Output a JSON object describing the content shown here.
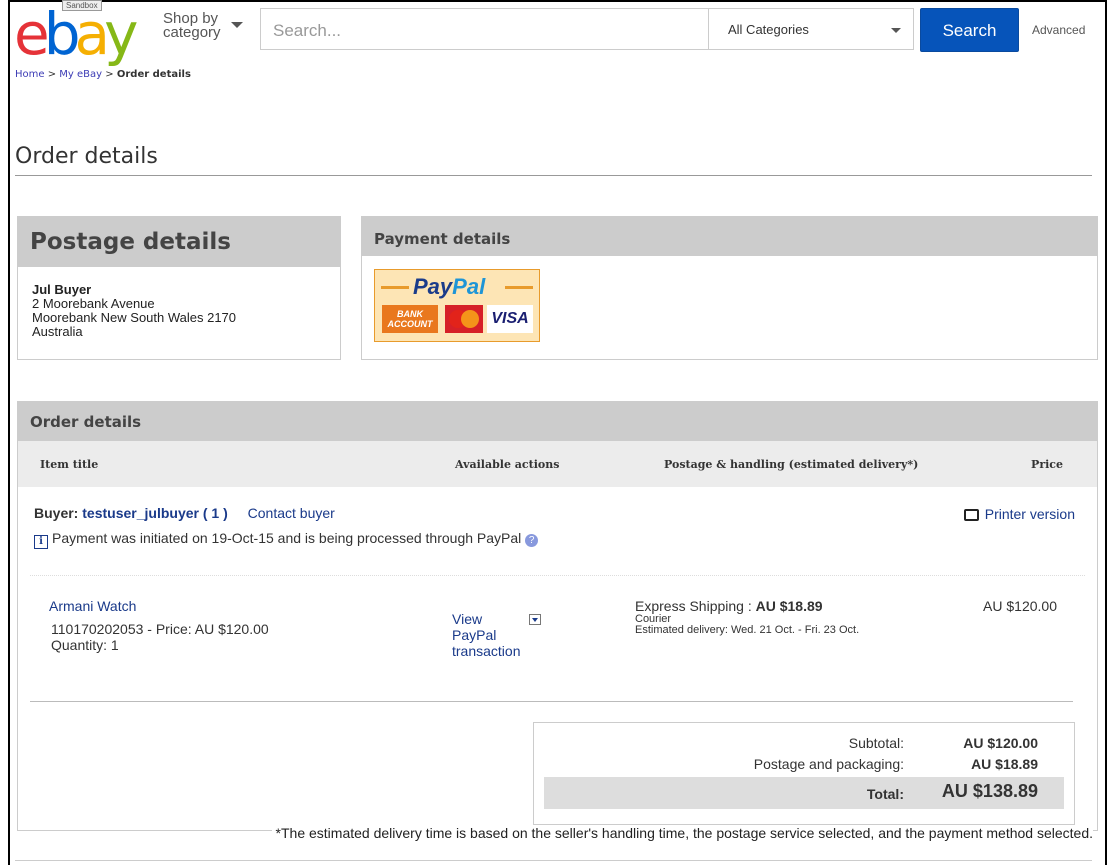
{
  "header": {
    "logo_text": "ebay",
    "sandbox_badge": "Sandbox",
    "shop_by_line1": "Shop by",
    "shop_by_line2": "category",
    "search_placeholder": "Search...",
    "category_selected": "All Categories",
    "search_button": "Search",
    "advanced_link": "Advanced",
    "logo_colors": [
      "#e53238",
      "#0064d2",
      "#f5af02",
      "#86b817"
    ]
  },
  "breadcrumb": {
    "home": "Home",
    "my_ebay": "My eBay",
    "separator": ">",
    "current": "Order details"
  },
  "page_title": "Order details",
  "postage": {
    "heading": "Postage details",
    "name": "Jul Buyer",
    "address_line1": "2 Moorebank Avenue",
    "address_line2": "Moorebank New South Wales 2170",
    "country": "Australia"
  },
  "payment": {
    "heading": "Payment details",
    "paypal_pay": "Pay",
    "paypal_pal": "Pal",
    "bank_label_1": "BANK",
    "bank_label_2": "ACCOUNT",
    "visa_label": "VISA"
  },
  "order": {
    "heading": "Order details",
    "columns": {
      "item_title": "Item title",
      "actions": "Available actions",
      "postage": "Postage & handling (estimated delivery*)",
      "price": "Price"
    },
    "buyer_prefix": "Buyer:",
    "buyer_username": "testuser_julbuyer",
    "buyer_feedback": "( 1 )",
    "contact_buyer": "Contact buyer",
    "printer_version": "Printer version",
    "notice_icon": "i",
    "notice_text": "Payment was initiated on 19-Oct-15 and is being processed through PayPal",
    "help_icon": "?",
    "item": {
      "title": "Armani Watch",
      "number_price": "110170202053 - Price: AU $120.00",
      "quantity": "Quantity: 1",
      "action_line1": "View",
      "action_line2": "PayPal",
      "action_line3": "transaction",
      "shipping_label": "Express Shipping :",
      "shipping_cost": "AU $18.89",
      "carrier": "Courier",
      "estimated": "Estimated delivery: Wed. 21 Oct. - Fri. 23 Oct.",
      "price": "AU $120.00"
    },
    "totals": {
      "subtotal_label": "Subtotal:",
      "subtotal_value": "AU $120.00",
      "postage_label": "Postage and packaging:",
      "postage_value": "AU $18.89",
      "total_label": "Total:",
      "total_value": "AU $138.89"
    }
  },
  "footnote": "*The estimated delivery time is based on the seller's handling time, the postage service selected, and the payment method selected."
}
